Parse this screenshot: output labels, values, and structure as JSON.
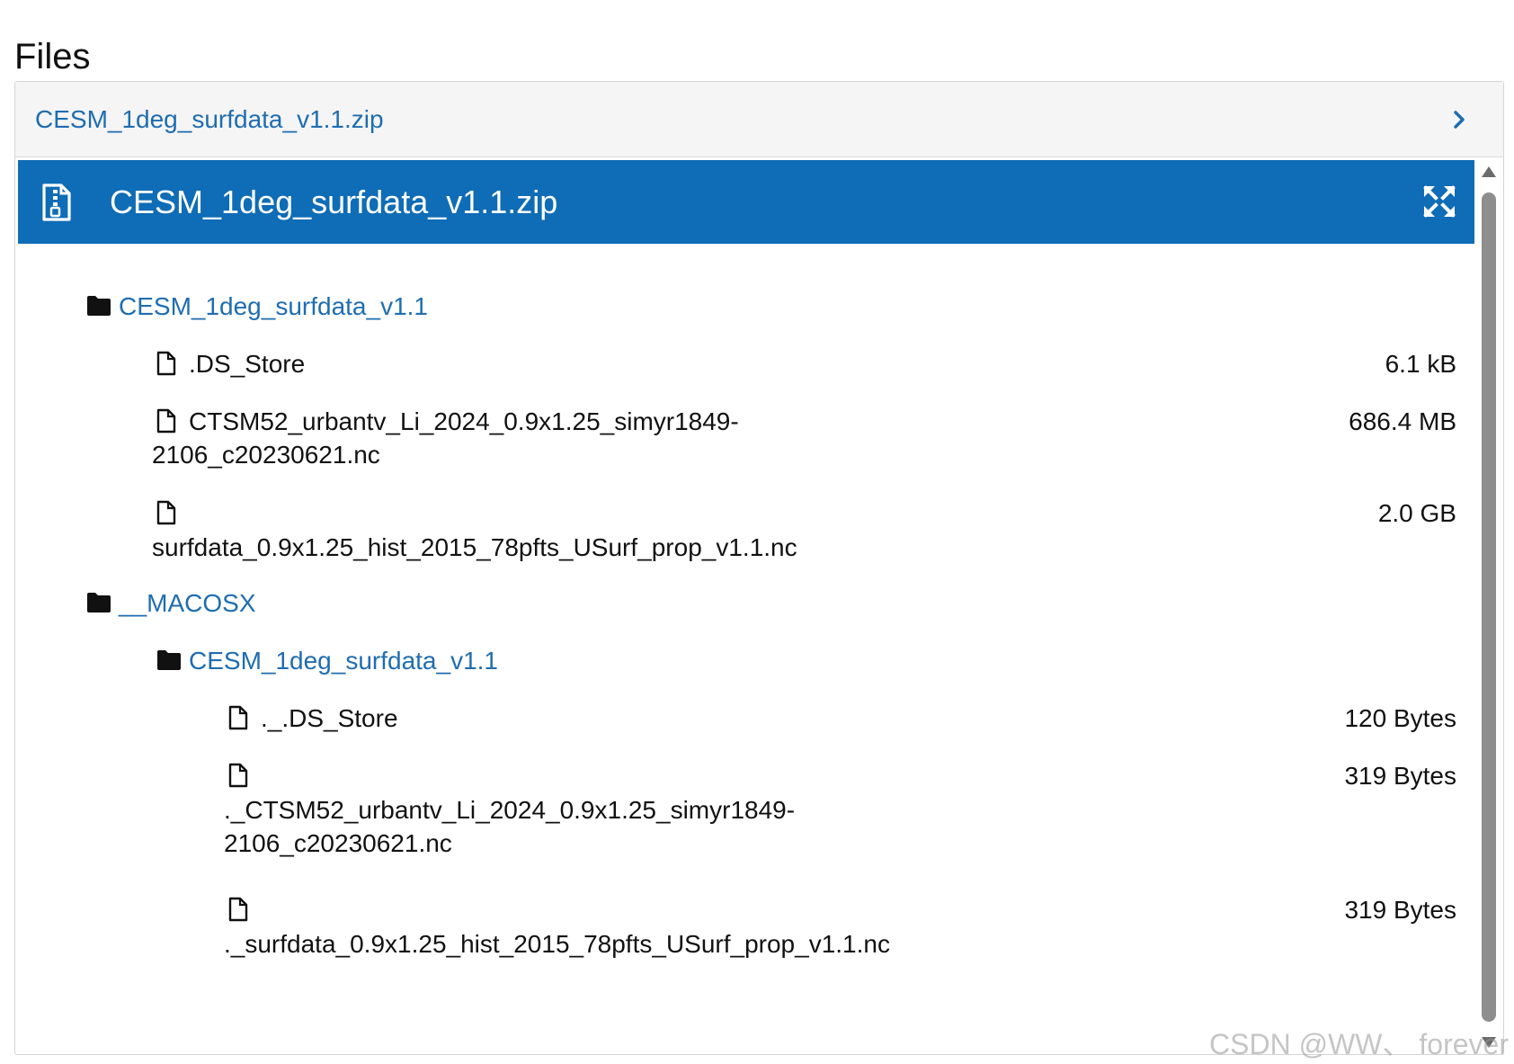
{
  "page": {
    "title": "Files"
  },
  "panel": {
    "header_link": "CESM_1deg_surfdata_v1.1.zip",
    "chevron_icon": "chevron-right-icon"
  },
  "preview": {
    "title": "CESM_1deg_surfdata_v1.1.zip",
    "file_icon": "file-zip-icon",
    "expand_icon": "expand-icon",
    "bar_color": "#0f6cb6"
  },
  "tree": {
    "folder_1": {
      "name": "CESM_1deg_surfdata_v1.1"
    },
    "file_1": {
      "name": ".DS_Store",
      "size": "6.1 kB"
    },
    "file_2": {
      "name_line1": "CTSM52_urbantv_Li_2024_0.9x1.25_simyr1849-",
      "name_line2": "2106_c20230621.nc",
      "size": "686.4 MB"
    },
    "file_3": {
      "name": "surfdata_0.9x1.25_hist_2015_78pfts_USurf_prop_v1.1.nc",
      "size": "2.0 GB"
    },
    "folder_2": {
      "name": "__MACOSX"
    },
    "folder_3": {
      "name": "CESM_1deg_surfdata_v1.1"
    },
    "file_4": {
      "name": "._.DS_Store",
      "size": "120 Bytes"
    },
    "file_5": {
      "name_line1": "._CTSM52_urbantv_Li_2024_0.9x1.25_simyr1849-",
      "name_line2": "2106_c20230621.nc",
      "size": "319 Bytes"
    },
    "file_6": {
      "name": "._surfdata_0.9x1.25_hist_2015_78pfts_USurf_prop_v1.1.nc",
      "size": "319 Bytes"
    }
  },
  "colors": {
    "link": "#1f6db0",
    "scroll_thumb": "#8e8e8e"
  },
  "watermark": "CSDN @WW、 forever"
}
